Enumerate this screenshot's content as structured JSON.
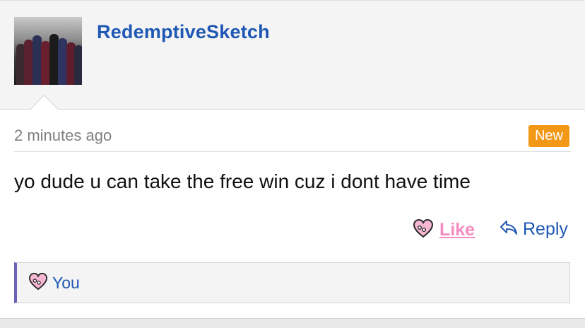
{
  "post": {
    "username": "RedemptiveSketch",
    "timestamp": "2 minutes ago",
    "badge": "New",
    "message": "yo dude u can take the free win cuz i dont have time"
  },
  "actions": {
    "like_label": "Like",
    "reply_label": "Reply"
  },
  "likes": {
    "label": "You"
  },
  "colors": {
    "username": "#1e57b4",
    "badge_bg": "#f39716",
    "like": "#f58cbf",
    "likes_border": "#6a63b8"
  },
  "icons": {
    "like": "heart-face-icon",
    "reply": "reply-arrow-icon"
  }
}
